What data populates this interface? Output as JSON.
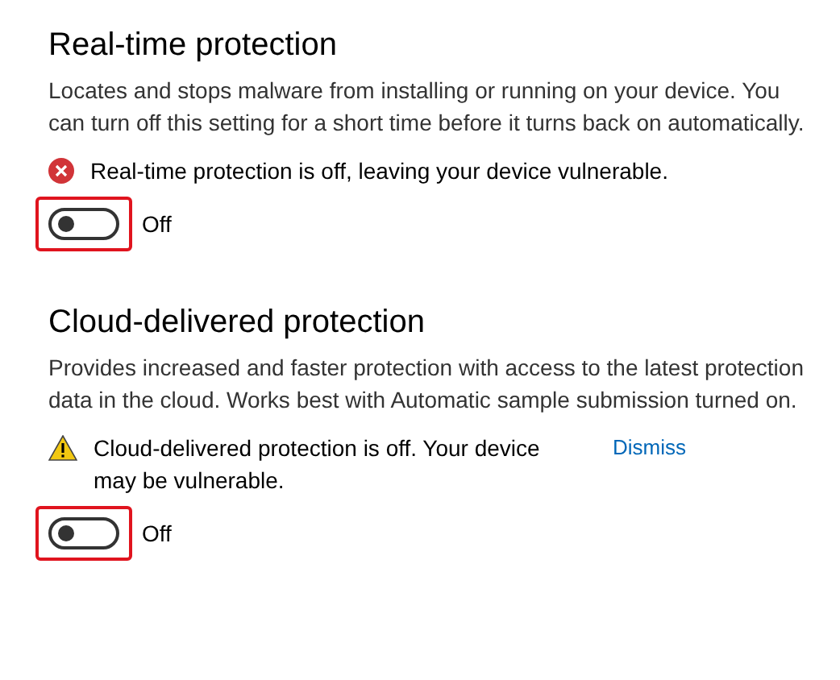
{
  "sections": [
    {
      "title": "Real-time protection",
      "description": "Locates and stops malware from installing or running on your device. You can turn off this setting for a short time before it turns back on automatically.",
      "alert": {
        "kind": "error",
        "text": "Real-time protection is off, leaving your device vulnerable."
      },
      "toggle": {
        "on": false,
        "label": "Off",
        "highlighted": true
      }
    },
    {
      "title": "Cloud-delivered protection",
      "description": "Provides increased and faster protection with access to the latest protection data in the cloud. Works best with Automatic sample submission turned on.",
      "alert": {
        "kind": "warning",
        "text": "Cloud-delivered protection is off. Your device may be vulnerable.",
        "link": "Dismiss"
      },
      "toggle": {
        "on": false,
        "label": "Off",
        "highlighted": true
      }
    }
  ]
}
